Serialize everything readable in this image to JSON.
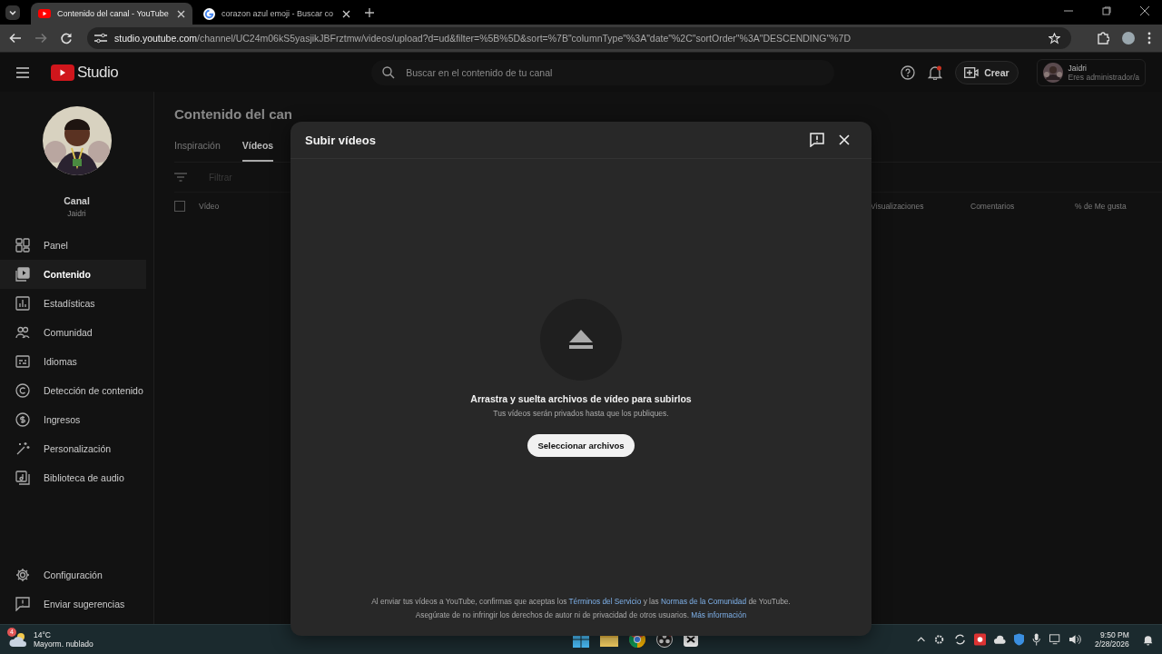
{
  "browser": {
    "tabs": [
      {
        "title": "Contenido del canal - YouTube",
        "selected": true,
        "kind": "youtube"
      },
      {
        "title": "corazon azul emoji - Buscar co",
        "selected": false,
        "kind": "google"
      }
    ],
    "url_host": "studio.youtube.com",
    "url_path": "/channel/UC24m06kS5yasjikJBFrztmw/videos/upload?d=ud&filter=%5B%5D&sort=%7B\"columnType\"%3A\"date\"%2C\"sortOrder\"%3A\"DESCENDING\"%7D"
  },
  "header": {
    "logo": "Studio",
    "search_placeholder": "Buscar en el contenido de tu canal",
    "create": "Crear",
    "account_name": "Jaidri",
    "account_role": "Eres administrador/a"
  },
  "sidebar": {
    "channel_label": "Canal",
    "channel_name": "Jaidri",
    "items": [
      {
        "label": "Panel",
        "kind": "dashboard",
        "selected": false
      },
      {
        "label": "Contenido",
        "kind": "content",
        "selected": true
      },
      {
        "label": "Estadísticas",
        "kind": "analytics",
        "selected": false
      },
      {
        "label": "Comunidad",
        "kind": "community",
        "selected": false
      },
      {
        "label": "Idiomas",
        "kind": "subtitles",
        "selected": false
      },
      {
        "label": "Detección de contenido",
        "kind": "copyright",
        "selected": false
      },
      {
        "label": "Ingresos",
        "kind": "earn",
        "selected": false
      },
      {
        "label": "Personalización",
        "kind": "customize",
        "selected": false
      },
      {
        "label": "Biblioteca de audio",
        "kind": "audio",
        "selected": false
      }
    ],
    "bottom_items": [
      {
        "label": "Configuración",
        "kind": "settings"
      },
      {
        "label": "Enviar sugerencias",
        "kind": "feedback"
      }
    ]
  },
  "content": {
    "title": "Contenido del can",
    "tabs": [
      {
        "label": "Inspiración",
        "selected": false
      },
      {
        "label": "Vídeos",
        "selected": true
      }
    ],
    "filter_placeholder": "Filtrar",
    "select_all_checked": false,
    "columns": [
      "Vídeo",
      "Visualizaciones",
      "Comentarios",
      "% de Me gusta"
    ]
  },
  "dialog": {
    "title": "Subir vídeos",
    "drop_title": "Arrastra y suelta archivos de vídeo para subirlos",
    "drop_note": "Tus vídeos serán privados hasta que los publiques.",
    "button": "Seleccionar archivos",
    "footer": [
      [
        {
          "text": "Al enviar tus vídeos a YouTube, confirmas que aceptas los ",
          "kind": "text"
        },
        {
          "text": "Términos del Servicio",
          "kind": "link"
        },
        {
          "text": " y las ",
          "kind": "text"
        },
        {
          "text": "Normas de la Comunidad",
          "kind": "link"
        },
        {
          "text": " de YouTube.",
          "kind": "text"
        }
      ],
      [
        {
          "text": "Asegúrate de no infringir los derechos de autor ni de privacidad de otros usuarios. ",
          "kind": "text"
        },
        {
          "text": "Más información",
          "kind": "link"
        }
      ]
    ]
  },
  "taskbar": {
    "temperature": "14°C",
    "weather": "Mayorm. nublado",
    "weather_badge": "4",
    "time": "9:50 PM",
    "date": "2/28/2026"
  }
}
